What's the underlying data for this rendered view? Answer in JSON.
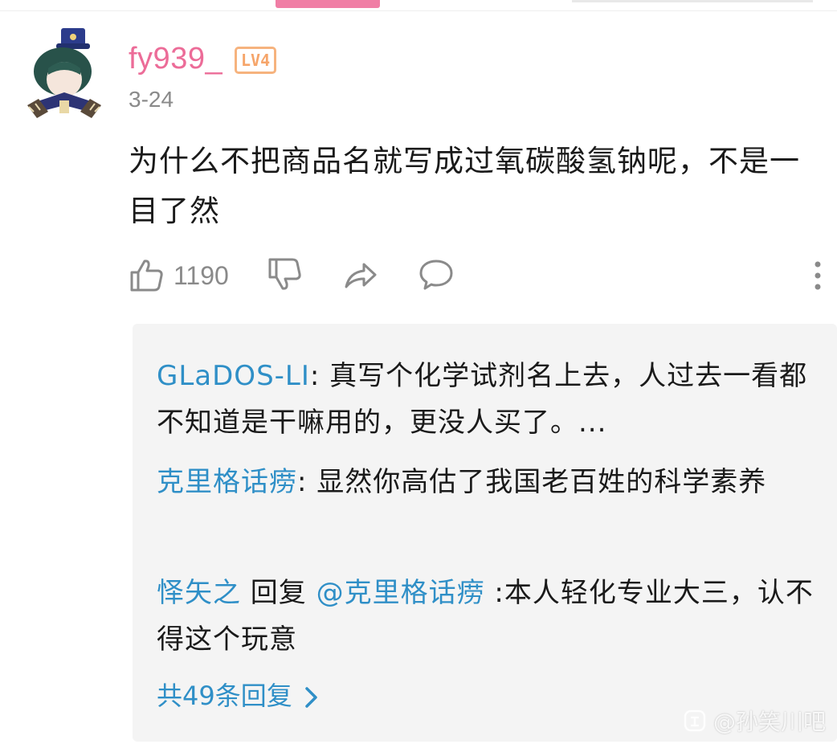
{
  "comment": {
    "username": "fy939_",
    "level": "LV4",
    "date": "3-24",
    "text": "为什么不把商品名就写成过氧碳酸氢钠呢，不是一目了然",
    "like_count": "1190"
  },
  "replies": [
    {
      "user": "GLaDOS-LI",
      "separator": ": ",
      "text": "真写个化学试剂名上去，人过去一看都不知道是干嘛用的，更没人买了。..."
    },
    {
      "user": "克里格话痨",
      "separator": ": ",
      "text": "显然你高估了我国老百姓的科学素养"
    },
    {
      "user": "怿矢之",
      "reply_word": " 回复 ",
      "mention": "@克里格话痨",
      "separator": " :",
      "text": "本人轻化专业大三，认不得这个玩意"
    }
  ],
  "more_replies": "共49条回复",
  "watermark": "@孙笑川吧",
  "colors": {
    "username": "#ec6c98",
    "link": "#2f8fc7",
    "level_badge": "#f6a56a",
    "tab_indicator": "#f07ea5",
    "reply_bg": "#f4f4f4"
  },
  "icons": [
    "thumbs-up-icon",
    "thumbs-down-icon",
    "share-icon",
    "comment-bubble-icon",
    "more-vertical-icon",
    "chevron-right-icon"
  ]
}
